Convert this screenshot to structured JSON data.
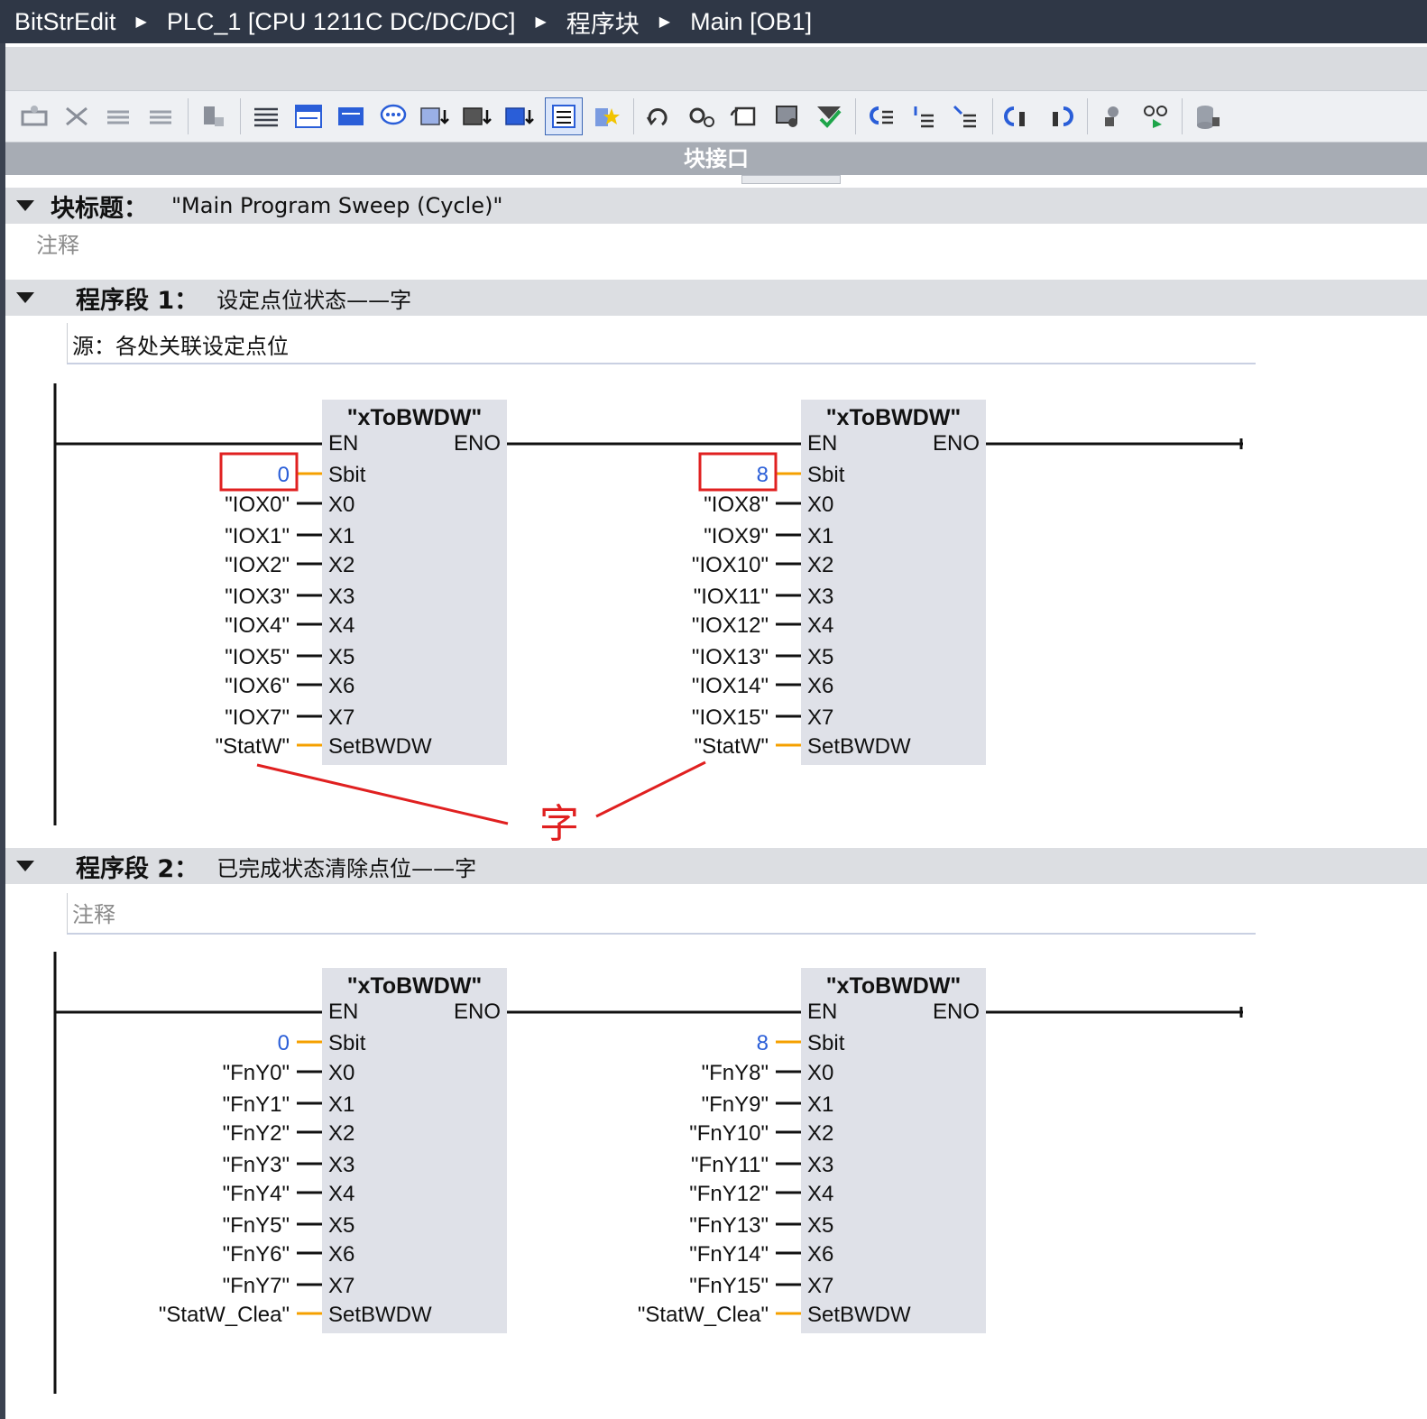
{
  "breadcrumb": [
    {
      "label": "BitStrEdit"
    },
    {
      "label": "PLC_1 [CPU 1211C DC/DC/DC]"
    },
    {
      "label": "程序块"
    },
    {
      "label": "Main [OB1]"
    }
  ],
  "toolbar": {
    "icons": [
      "insert-network-icon",
      "delete-network-icon",
      "insert-row-icon",
      "append-row-icon",
      "copy-icon",
      "expand-all-icon",
      "collapse-icon",
      "absolute-operands-icon",
      "comment-icon",
      "favorites-icon",
      "move-up-icon",
      "move-down-icon",
      "networks-view-icon",
      "star-icon",
      "previous-error-icon",
      "next-error-icon",
      "update-calls-icon",
      "monitor-icon",
      "compile-icon",
      "go-to-icon",
      "network-title-icon",
      "nesting-icon",
      "open-block-icon",
      "close-block-icon",
      "view-icon",
      "monitoring-on-icon",
      "database-icon"
    ]
  },
  "interface_bar": {
    "label": "块接口"
  },
  "block_title": {
    "label": "块标题：",
    "value": "\"Main Program Sweep (Cycle)\"",
    "comment": "注释"
  },
  "network1": {
    "label": "程序段 1：",
    "title": "设定点位状态——字",
    "comment": "源：各处关联设定点位",
    "annotation": "字",
    "blocks": [
      {
        "name": "\"xToBWDW\"",
        "en": "EN",
        "eno": "ENO",
        "sbit_pin": "Sbit",
        "sbit_value": "0",
        "pins": [
          "X0",
          "X1",
          "X2",
          "X3",
          "X4",
          "X5",
          "X6",
          "X7"
        ],
        "operands": [
          "\"IOX0\"",
          "\"IOX1\"",
          "\"IOX2\"",
          "\"IOX3\"",
          "\"IOX4\"",
          "\"IOX5\"",
          "\"IOX6\"",
          "\"IOX7\""
        ],
        "out_pin": "SetBWDW",
        "out_operand": "\"StatW\""
      },
      {
        "name": "\"xToBWDW\"",
        "en": "EN",
        "eno": "ENO",
        "sbit_pin": "Sbit",
        "sbit_value": "8",
        "pins": [
          "X0",
          "X1",
          "X2",
          "X3",
          "X4",
          "X5",
          "X6",
          "X7"
        ],
        "operands": [
          "\"IOX8\"",
          "\"IOX9\"",
          "\"IOX10\"",
          "\"IOX11\"",
          "\"IOX12\"",
          "\"IOX13\"",
          "\"IOX14\"",
          "\"IOX15\""
        ],
        "out_pin": "SetBWDW",
        "out_operand": "\"StatW\""
      }
    ]
  },
  "network2": {
    "label": "程序段 2：",
    "title": "已完成状态清除点位——字",
    "comment": "注释",
    "blocks": [
      {
        "name": "\"xToBWDW\"",
        "en": "EN",
        "eno": "ENO",
        "sbit_pin": "Sbit",
        "sbit_value": "0",
        "pins": [
          "X0",
          "X1",
          "X2",
          "X3",
          "X4",
          "X5",
          "X6",
          "X7"
        ],
        "operands": [
          "\"FnY0\"",
          "\"FnY1\"",
          "\"FnY2\"",
          "\"FnY3\"",
          "\"FnY4\"",
          "\"FnY5\"",
          "\"FnY6\"",
          "\"FnY7\""
        ],
        "out_pin": "SetBWDW",
        "out_operand": "\"StatW_Clea\""
      },
      {
        "name": "\"xToBWDW\"",
        "en": "EN",
        "eno": "ENO",
        "sbit_pin": "Sbit",
        "sbit_value": "8",
        "pins": [
          "X0",
          "X1",
          "X2",
          "X3",
          "X4",
          "X5",
          "X6",
          "X7"
        ],
        "operands": [
          "\"FnY8\"",
          "\"FnY9\"",
          "\"FnY10\"",
          "\"FnY11\"",
          "\"FnY12\"",
          "\"FnY13\"",
          "\"FnY14\"",
          "\"FnY15\""
        ],
        "out_pin": "SetBWDW",
        "out_operand": "\"StatW_Clea\""
      }
    ]
  },
  "colors": {
    "block_fill": "#dfe1e8",
    "highlight": "#e02020",
    "wire_orange": "#f5a000",
    "value_blue": "#2a5ed8",
    "annotation_red": "#e02020"
  }
}
